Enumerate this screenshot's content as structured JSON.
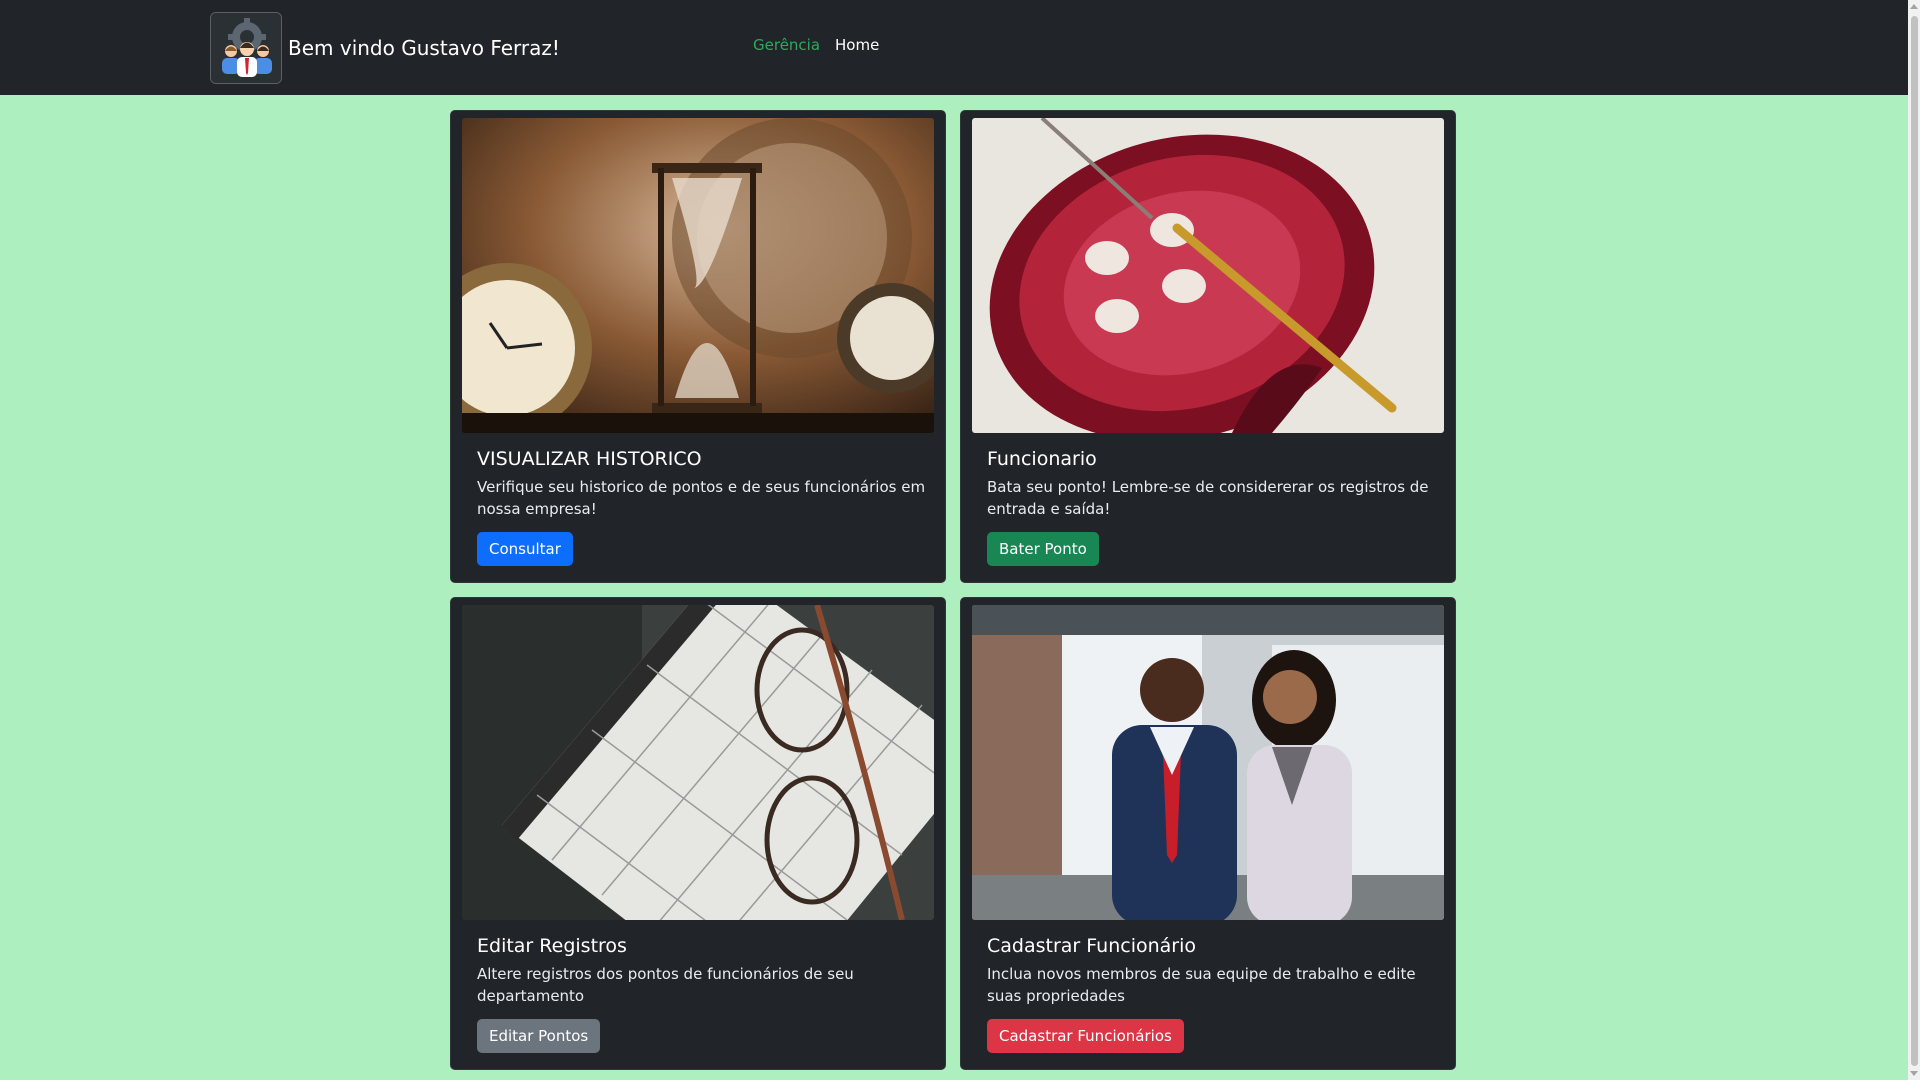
{
  "navbar": {
    "brand_text": "Bem vindo Gustavo Ferraz!",
    "logo_icon": "team-management-icon",
    "links": [
      {
        "label": "Gerência",
        "active": true
      },
      {
        "label": "Home",
        "active": false
      }
    ],
    "active_color": "#2ea95f"
  },
  "cards": [
    {
      "image": "hourglass-and-clocks-photo",
      "title": "VISUALIZAR HISTORICO",
      "text": "Verifique seu historico de pontos e de seus funcionários em nossa empresa!",
      "button": "Consultar",
      "button_color": "#0d6efd"
    },
    {
      "image": "red-button-with-needle-photo",
      "title": "Funcionario",
      "text": "Bata seu ponto! Lembre-se de considererar os registros de entrada e saída!",
      "button": "Bater Ponto",
      "button_color": "#198754"
    },
    {
      "image": "calendar-and-glasses-photo",
      "title": "Editar Registros",
      "text": "Altere registros dos pontos de funcionários de seu departamento",
      "button": "Editar Pontos",
      "button_color": "#6c757d"
    },
    {
      "image": "business-people-photo",
      "title": "Cadastrar Funcionário",
      "text": "Inclua novos membros de sua equipe de trabalho e edite suas propriedades",
      "button": "Cadastrar Funcionários",
      "button_color": "#dc3545"
    }
  ],
  "colors": {
    "page_background": "#aeefbf",
    "navbar_background": "#212529",
    "card_background": "#212529"
  }
}
